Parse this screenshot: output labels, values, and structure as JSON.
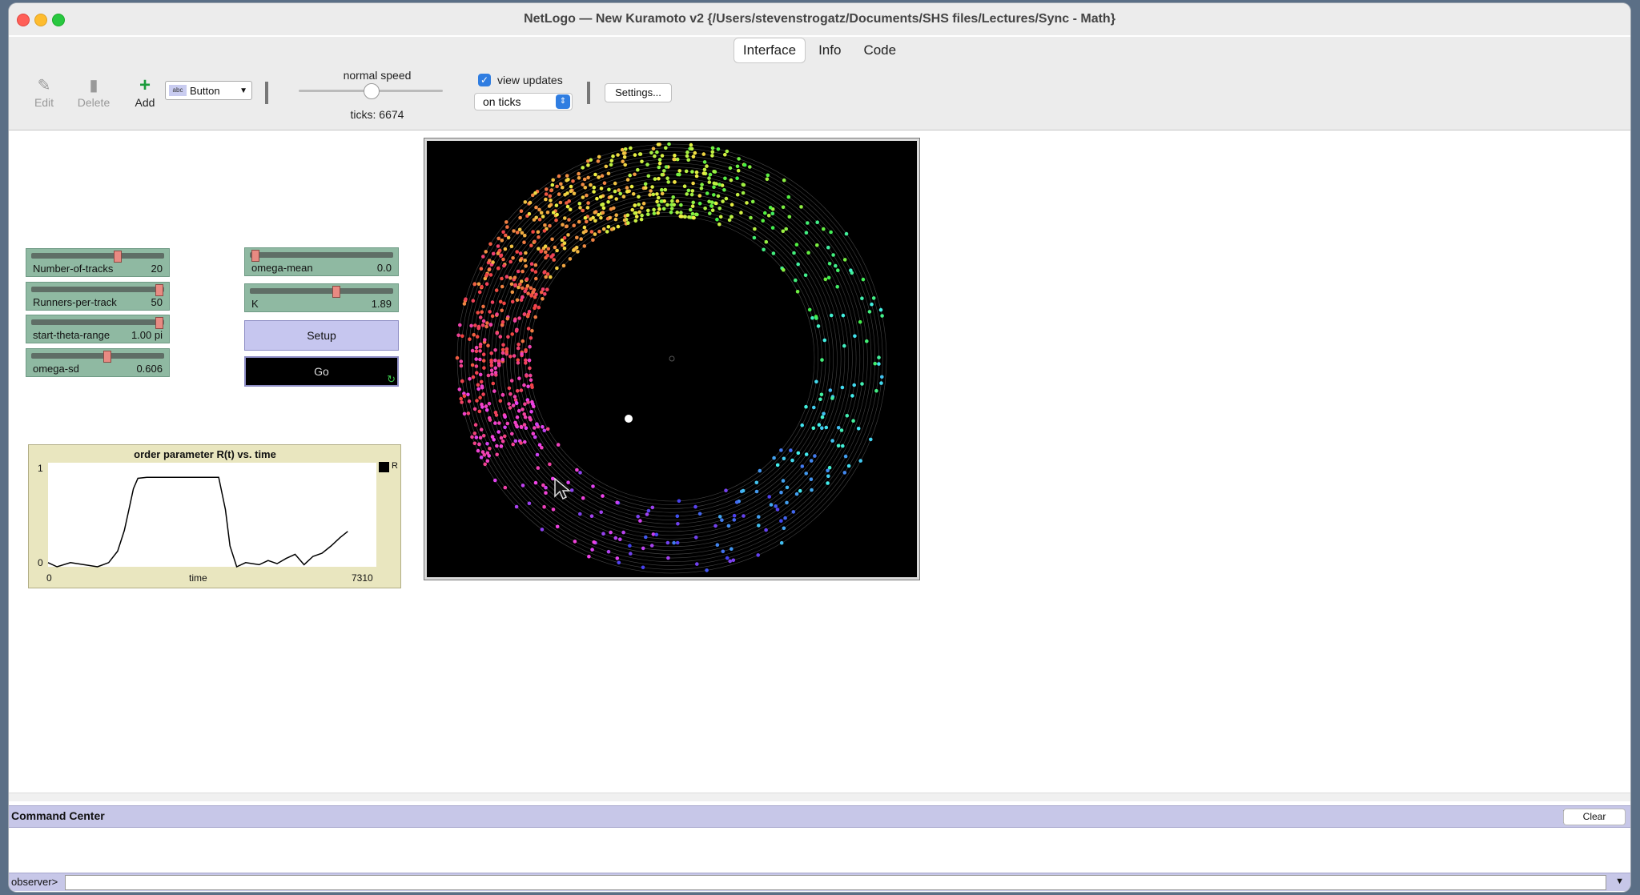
{
  "window": {
    "title": "NetLogo — New Kuramoto v2 {/Users/stevenstrogatz/Documents/SHS files/Lectures/Sync - Math}"
  },
  "tabs": [
    {
      "label": "Interface",
      "active": true
    },
    {
      "label": "Info",
      "active": false
    },
    {
      "label": "Code",
      "active": false
    }
  ],
  "toolbar": {
    "edit_label": "Edit",
    "delete_label": "Delete",
    "add_label": "Add",
    "widget_type": "Button",
    "widget_type_icon_text": "abc",
    "speed_label": "normal speed",
    "speed_fraction": 0.5,
    "ticks_label": "ticks: 6674",
    "view_updates_label": "view updates",
    "view_updates_checked": true,
    "update_mode": "on ticks",
    "settings_label": "Settings..."
  },
  "sliders": [
    {
      "name": "Number-of-tracks",
      "value": "20",
      "fraction": 0.65
    },
    {
      "name": "Runners-per-track",
      "value": "50",
      "fraction": 0.98
    },
    {
      "name": "start-theta-range",
      "value": "1.00 pi",
      "fraction": 0.98
    },
    {
      "name": "omega-sd",
      "value": "0.606",
      "fraction": 0.57
    },
    {
      "name": "omega-mean",
      "value": "0.0",
      "fraction": 0.01
    },
    {
      "name": "K",
      "value": "1.89",
      "fraction": 0.6
    }
  ],
  "buttons": {
    "setup_label": "Setup",
    "go_label": "Go",
    "forever_icon": "↻"
  },
  "plot": {
    "title": "order parameter R(t) vs. time",
    "pen_label": "R",
    "y_max_label": "1",
    "y_min_label": "0",
    "x_min_label": "0",
    "x_max_label": "7310",
    "x_axis_label": "time",
    "pen_color": "#000000"
  },
  "chart_data": {
    "type": "line",
    "title": "order parameter R(t) vs. time",
    "xlabel": "time",
    "ylabel": "",
    "xlim": [
      0,
      7310
    ],
    "ylim": [
      0,
      1
    ],
    "series": [
      {
        "name": "R",
        "x": [
          0,
          200,
          500,
          800,
          1100,
          1350,
          1550,
          1700,
          1800,
          1900,
          2000,
          2200,
          2500,
          3000,
          3500,
          3800,
          3950,
          4050,
          4200,
          4400,
          4700,
          4900,
          5100,
          5300,
          5500,
          5700,
          5900,
          6100,
          6300,
          6500,
          6674
        ],
        "y": [
          0.04,
          0.0,
          0.04,
          0.02,
          0.0,
          0.04,
          0.15,
          0.35,
          0.55,
          0.75,
          0.85,
          0.86,
          0.86,
          0.86,
          0.86,
          0.86,
          0.55,
          0.2,
          0.0,
          0.04,
          0.02,
          0.06,
          0.03,
          0.08,
          0.12,
          0.02,
          0.1,
          0.13,
          0.2,
          0.28,
          0.34
        ]
      }
    ]
  },
  "view": {
    "ring_count": 20,
    "runners_per_ring": 50,
    "synced_color_phase": 0.45
  },
  "command_center": {
    "title": "Command Center",
    "clear_label": "Clear",
    "expand_icon": "expand-icon",
    "prompt_label": "observer>",
    "input_value": ""
  }
}
